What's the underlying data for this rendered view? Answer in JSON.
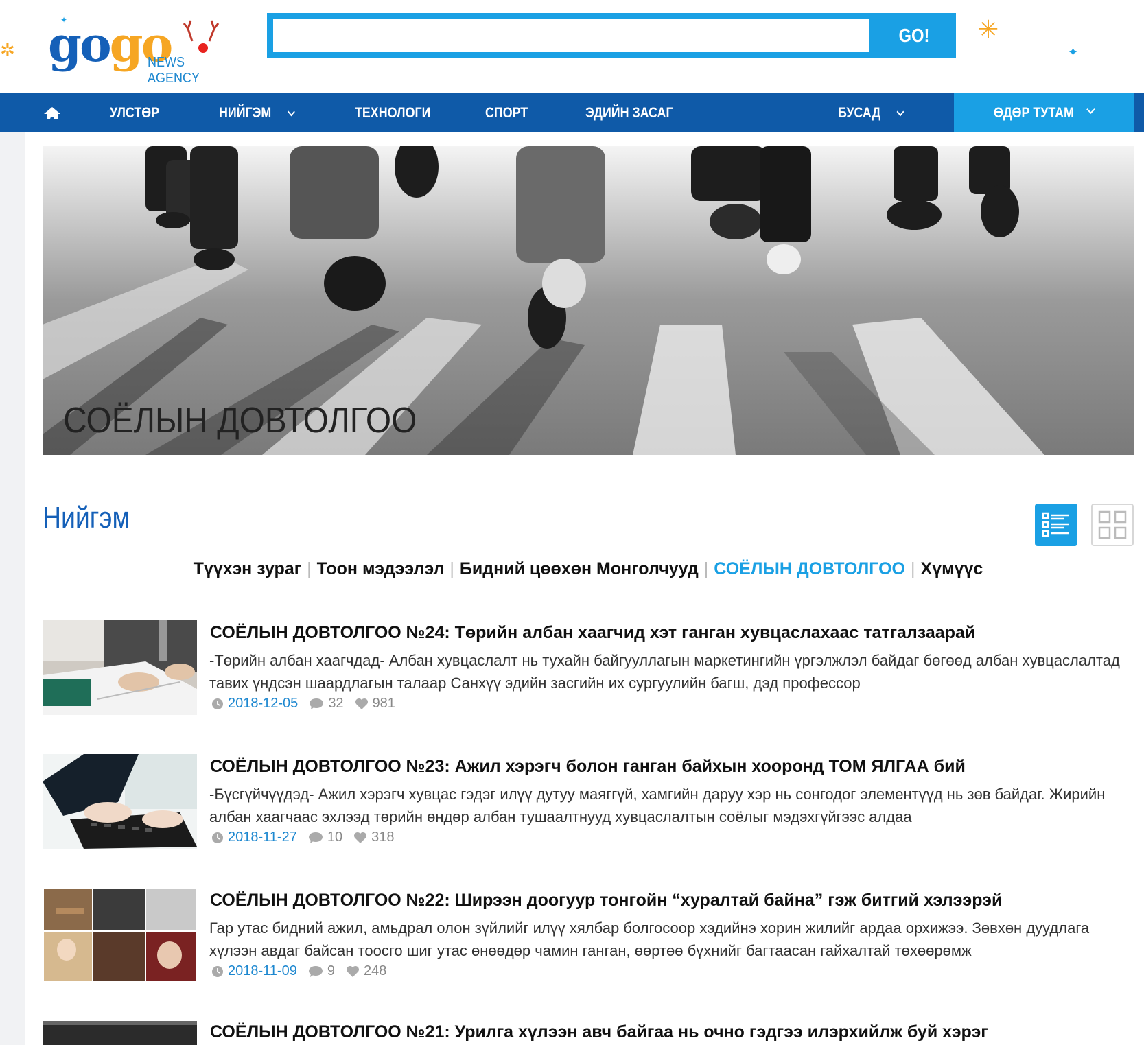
{
  "header": {
    "logo_text_a": "go",
    "logo_text_b": "go",
    "logo_sub": "NEWS AGENCY",
    "search_value": "",
    "search_button": "GO!"
  },
  "nav": {
    "items": [
      "УЛСТӨР",
      "НИЙГЭМ",
      "ТЕХНОЛОГИ",
      "СПОРТ",
      "ЭДИЙН ЗАСАГ",
      "БУСАД"
    ],
    "daily": "ӨДӨР ТУТАМ"
  },
  "banner": {
    "title": "СОЁЛЫН ДОВТОЛГОО"
  },
  "section": {
    "title": "Нийгэм"
  },
  "subcategories": [
    {
      "label": "Түүхэн зураг",
      "active": false
    },
    {
      "label": "Тоон мэдээлэл",
      "active": false
    },
    {
      "label": "Бидний цөөхөн Монголчууд",
      "active": false
    },
    {
      "label": "СОЁЛЫН ДОВТОЛГОО",
      "active": true
    },
    {
      "label": "Хүмүүс",
      "active": false
    }
  ],
  "articles": [
    {
      "title": "СОЁЛЫН ДОВТОЛГОО №24: Төрийн албан хаагчид хэт ганган хувцаслахаас татгалзаарай",
      "excerpt": "-Төрийн албан хаагчдад- Албан хувцаслалт нь тухайн байгууллагын маркетингийн үргэлжлэл байдаг бөгөөд албан хувцаслалтад тавих үндсэн шаардлагын талаар Санхүү эдийн засгийн их сургуулийн багш, дэд профессор",
      "date": "2018-12-05",
      "comments": "32",
      "likes": "981"
    },
    {
      "title": "СОЁЛЫН ДОВТОЛГОО №23: Ажил хэрэгч болон ганган байхын хооронд ТОМ ЯЛГАА бий",
      "excerpt": "-Бүсгүйчүүдэд- Ажил хэрэгч хувцас гэдэг илүү дутуу маяггүй, хамгийн даруу хэр нь сонгодог элементүүд нь зөв байдаг. Жирийн албан хаагчаас эхлээд төрийн өндөр албан тушаалтнууд хувцаслалтын соёлыг мэдэхгүйгээс алдаа",
      "date": "2018-11-27",
      "comments": "10",
      "likes": "318"
    },
    {
      "title": "СОЁЛЫН ДОВТОЛГОО №22: Ширээн доогуур тонгойн “хуралтай байна” гэж битгий хэлээрэй",
      "excerpt": "Гар утас бидний ажил, амьдрал олон зүйлийг илүү хялбар болгосоор хэдийнэ хорин жилийг ардаа орхижээ. Зөвхөн дуудлага хүлээн авдаг байсан тоосго шиг утас өнөөдөр чамин ганган, өөртөө бүхнийг багтаасан гайхалтай төхөөрөмж",
      "date": "2018-11-09",
      "comments": "9",
      "likes": "248"
    },
    {
      "title": "СОЁЛЫН ДОВТОЛГОО №21: Урилга хүлээн авч байгаа нь очно гэдгээ илэрхийлж буй хэрэг",
      "excerpt": "",
      "date": "",
      "comments": "",
      "likes": ""
    }
  ],
  "colors": {
    "brand_blue": "#0f5aa8",
    "accent_cyan": "#1aa0e4",
    "logo_orange": "#f6a623"
  }
}
